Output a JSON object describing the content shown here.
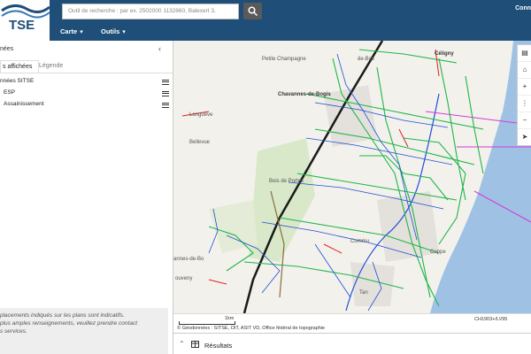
{
  "header": {
    "logo_text": "TSE",
    "search_placeholder": "Outil de recherche : par ex. 2502000 1132860, Balexert 3,",
    "menus": [
      "Carte",
      "Outils"
    ],
    "connect_label": "Conn"
  },
  "panel": {
    "title": "nées",
    "tabs": [
      "s affichées",
      "Légende"
    ],
    "layers": [
      "nnées SITSE",
      "ESP",
      "Assainissement"
    ],
    "disclaimer": "placements indiqués sur les plans sont indicatifs.\n plus amples renseignements, veuillez prendre contact\ns services."
  },
  "map": {
    "places": [
      "Petite Champagne",
      "Chavannes-de-Bogis",
      "Longuève",
      "Bellevue",
      "Bois de Portes",
      "Commu",
      "Céligny",
      "Coppe",
      "Tan",
      "annes-de-Bo",
      "ouveny",
      "de-Bos"
    ],
    "scale_label": "1km",
    "attribution": "© Géodonnées : SITSE, OIT, ASIT VD, Office fédéral de topographie",
    "crs": "CH1903+/LV95",
    "colors": {
      "water": "#9fc2e4",
      "network_green": "#1fb64a",
      "network_blue": "#1e4fd8",
      "network_red": "#e02020",
      "network_magenta": "#d23ad6",
      "forest": "#d8e8c8"
    }
  },
  "results": {
    "label": "Résultats"
  }
}
